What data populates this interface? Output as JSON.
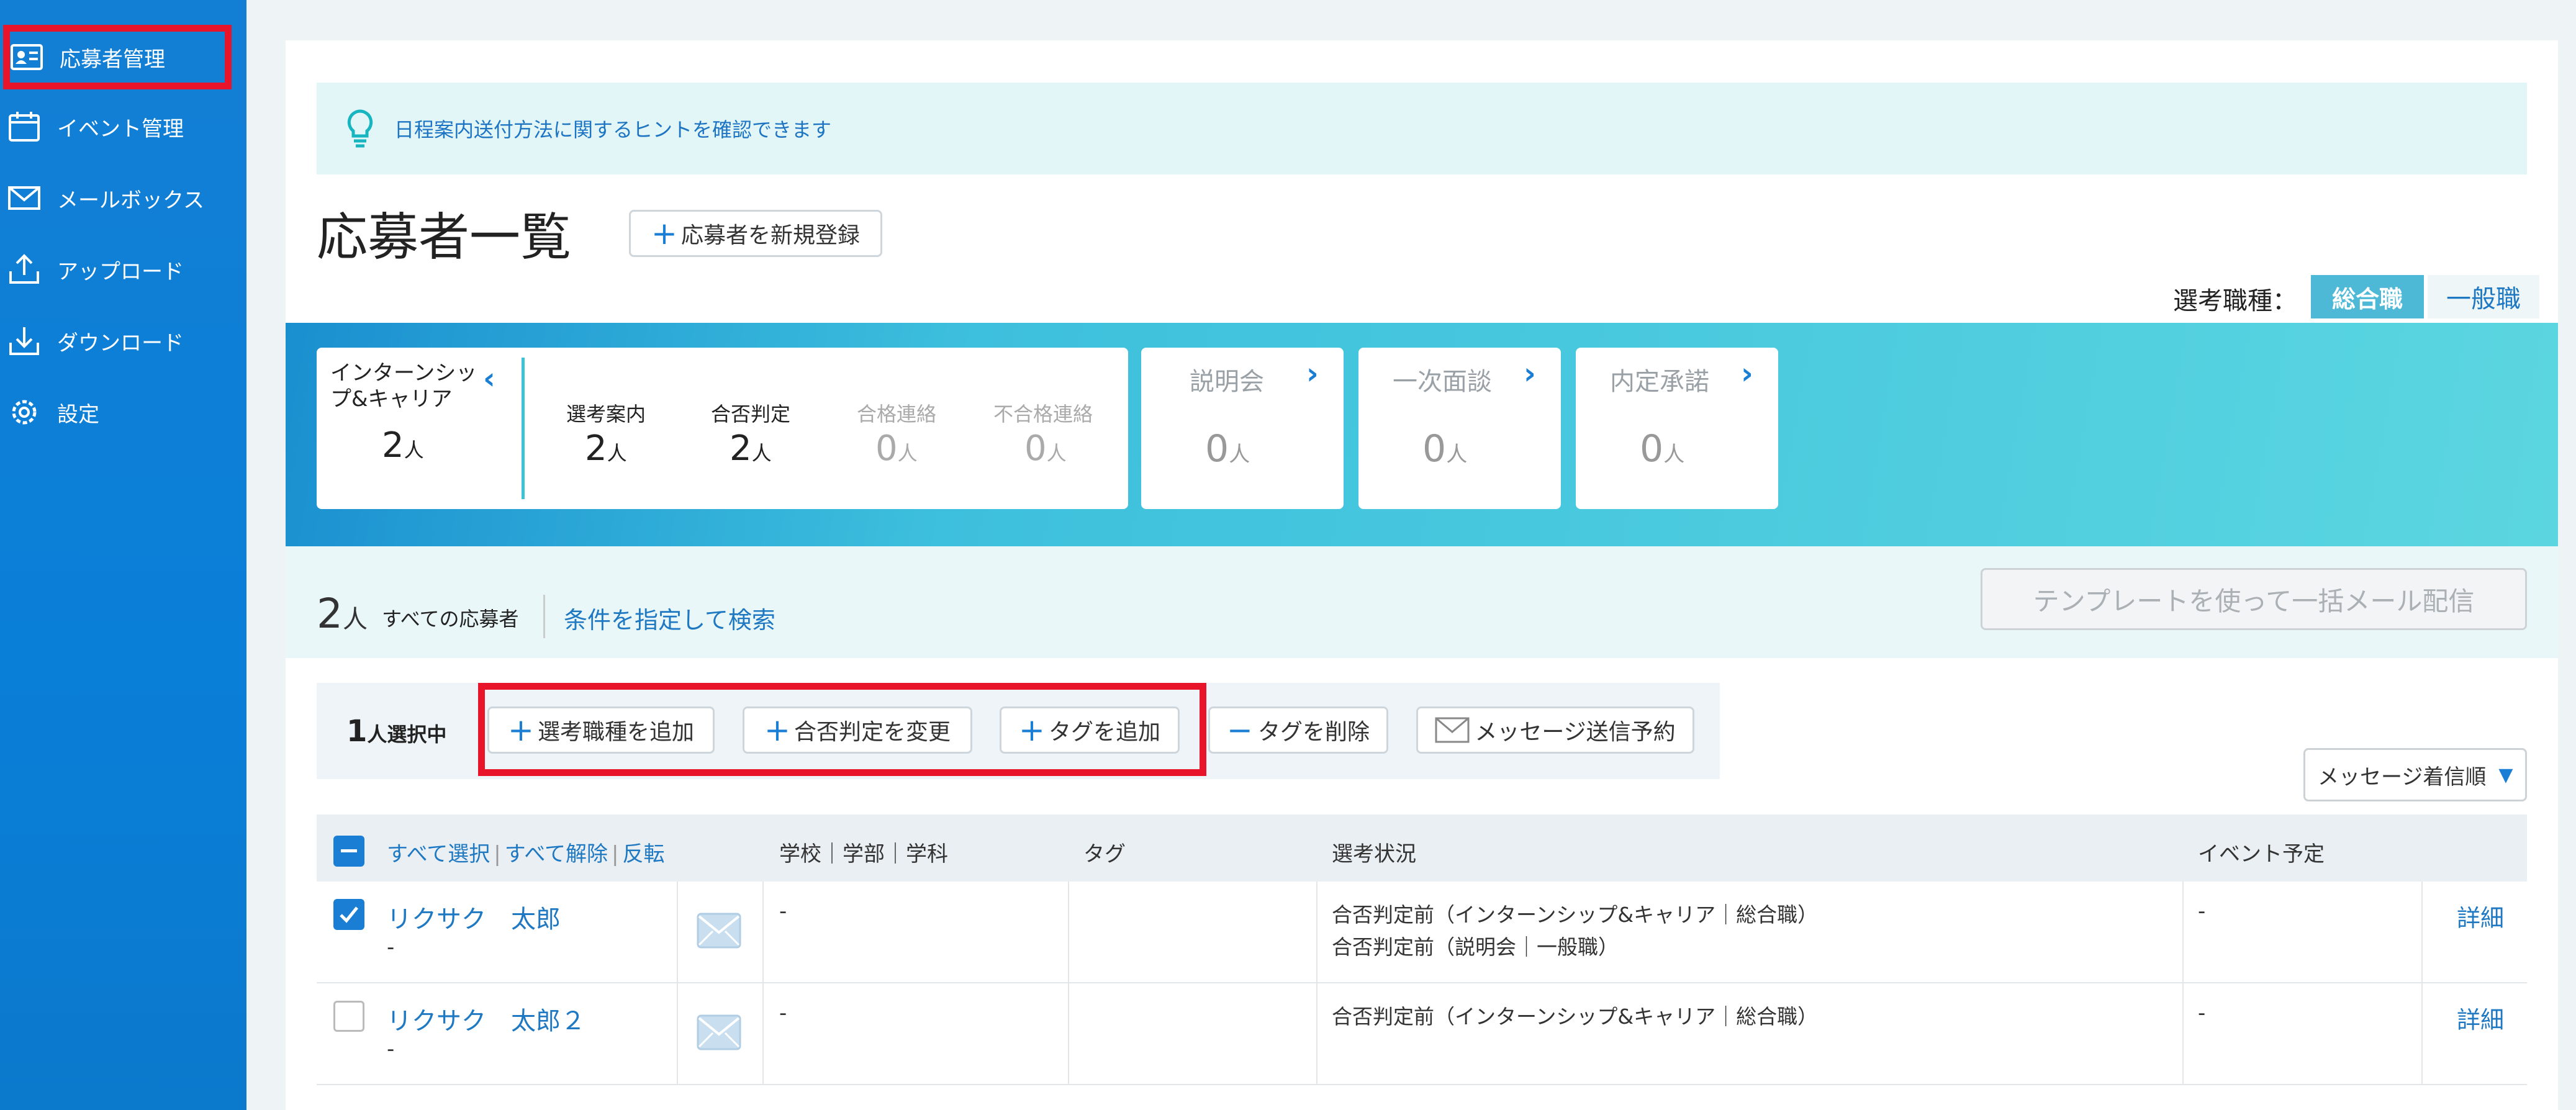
{
  "sidebar": {
    "items": [
      {
        "label": "応募者管理",
        "icon": "applicant-card-icon",
        "active": true
      },
      {
        "label": "イベント管理",
        "icon": "calendar-icon"
      },
      {
        "label": "メールボックス",
        "icon": "mail-icon"
      },
      {
        "label": "アップロード",
        "icon": "upload-icon"
      },
      {
        "label": "ダウンロード",
        "icon": "download-icon"
      },
      {
        "label": "設定",
        "icon": "gear-icon"
      }
    ]
  },
  "hint": {
    "text": "日程案内送付方法に関するヒントを確認できます",
    "icon": "lightbulb-icon"
  },
  "page": {
    "title": "応募者一覧",
    "register_label": "応募者を新規登録"
  },
  "jobtype": {
    "label": "選考職種：",
    "options": [
      "総合職",
      "一般職"
    ],
    "selected": "総合職"
  },
  "pipeline": {
    "main": {
      "name": "インターンシップ&キャリア",
      "count": "2",
      "unit": "人",
      "substages": [
        {
          "name": "選考案内",
          "count": "2",
          "unit": "人"
        },
        {
          "name": "合否判定",
          "count": "2",
          "unit": "人"
        },
        {
          "name": "合格連絡",
          "count": "0",
          "unit": "人"
        },
        {
          "name": "不合格連絡",
          "count": "0",
          "unit": "人"
        }
      ]
    },
    "stages": [
      {
        "name": "説明会",
        "count": "0",
        "unit": "人"
      },
      {
        "name": "一次面談",
        "count": "0",
        "unit": "人"
      },
      {
        "name": "内定承諾",
        "count": "0",
        "unit": "人"
      }
    ]
  },
  "summary": {
    "count": "2",
    "unit": "人",
    "label": "すべての応募者",
    "search_link": "条件を指定して検索",
    "bulk_mail_label": "テンプレートを使って一括メール配信"
  },
  "actions": {
    "selected_count": "1",
    "selected_unit": "人選択中",
    "add_jobtype": "選考職種を追加",
    "change_result": "合否判定を変更",
    "add_tag": "タグを追加",
    "remove_tag": "タグを削除",
    "schedule_message": "メッセージ送信予約"
  },
  "sort": {
    "label": "メッセージ着信順"
  },
  "table": {
    "select_all": "すべて選択",
    "deselect_all": "すべて解除",
    "invert": "反転",
    "columns": {
      "school": "学校｜学部｜学科",
      "tag": "タグ",
      "status": "選考状況",
      "event": "イベント予定"
    },
    "rows": [
      {
        "name": "リクサク　太郎",
        "sub": "-",
        "checked": true,
        "school": "-",
        "tag": "",
        "status": [
          "合否判定前（インターンシップ&キャリア｜総合職）",
          "合否判定前（説明会｜一般職）"
        ],
        "event": "-",
        "detail": "詳細"
      },
      {
        "name": "リクサク　太郎２",
        "sub": "-",
        "checked": false,
        "school": "-",
        "tag": "",
        "status": [
          "合否判定前（インターンシップ&キャリア｜総合職）"
        ],
        "event": "-",
        "detail": "詳細"
      }
    ]
  },
  "colors": {
    "accent": "#1a7fd4",
    "highlight": "#e8152a",
    "selected_tab": "#4db9d6"
  }
}
